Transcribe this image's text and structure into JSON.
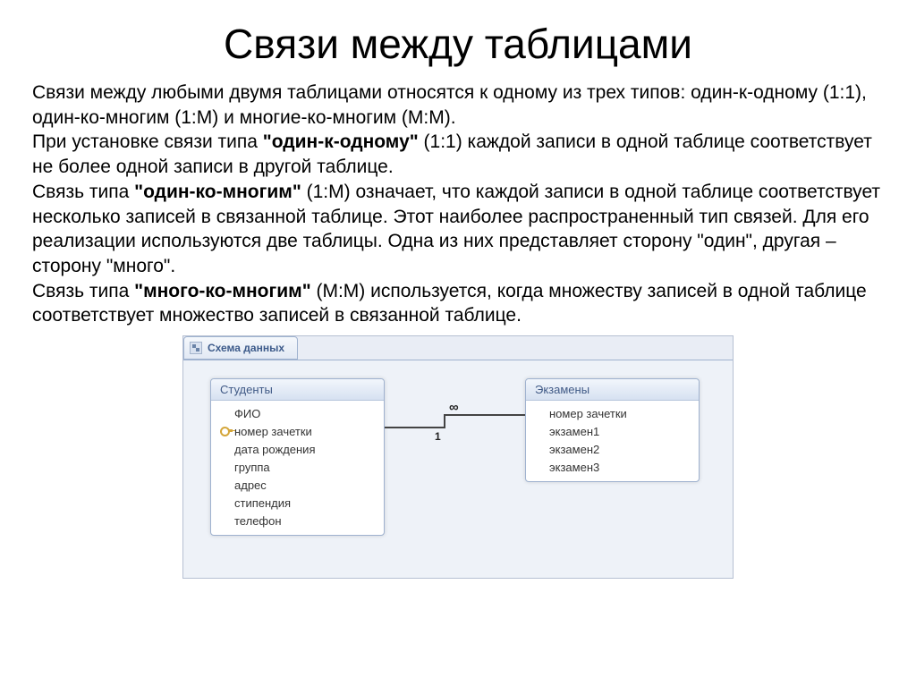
{
  "title": "Связи между таблицами",
  "text": {
    "intro1": "Связи между любыми двумя таблицами относятся к одному из трех типов: один-к-одному (1:1), один-ко-многим (1:М) и многие-ко-многим (М:М).",
    "p2a": "При установке связи типа ",
    "p2b": "\"один-к-одному\"",
    "p2c": " (1:1) каждой записи в одной таблице соответствует не более одной записи в другой таблице.",
    "p3a": "Связь типа ",
    "p3b": "\"один-ко-многим\"",
    "p3c": " (1:М) означает, что каждой записи в одной таблице соответствует несколько записей в связанной таблице. Этот наиболее распространенный тип связей. Для его реализации используются две таблицы. Одна из них представляет сторону \"один\", другая – сторону \"много\".",
    "p4a": "Связь типа ",
    "p4b": "\"много-ко-многим\"",
    "p4c": " (М:М) используется, когда множеству записей в одной таблице соответствует множество записей в связанной таблице."
  },
  "diagram": {
    "tab_label": "Схема данных",
    "relation": {
      "left_label": "1",
      "right_label": "∞"
    },
    "tables": {
      "left": {
        "name": "Студенты",
        "fields": [
          {
            "label": "ФИО",
            "key": false
          },
          {
            "label": "номер зачетки",
            "key": true
          },
          {
            "label": "дата рождения",
            "key": false
          },
          {
            "label": "группа",
            "key": false
          },
          {
            "label": "адрес",
            "key": false
          },
          {
            "label": "стипендия",
            "key": false
          },
          {
            "label": "телефон",
            "key": false
          }
        ]
      },
      "right": {
        "name": "Экзамены",
        "fields": [
          {
            "label": "номер зачетки",
            "key": false
          },
          {
            "label": "экзамен1",
            "key": false
          },
          {
            "label": "экзамен2",
            "key": false
          },
          {
            "label": "экзамен3",
            "key": false
          }
        ]
      }
    }
  }
}
